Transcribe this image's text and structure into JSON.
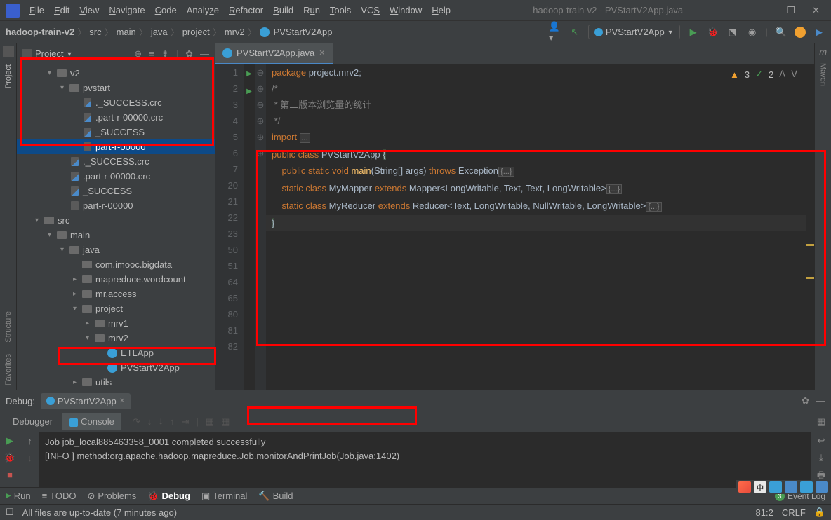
{
  "titlebar": {
    "menu": [
      "File",
      "Edit",
      "View",
      "Navigate",
      "Code",
      "Analyze",
      "Refactor",
      "Build",
      "Run",
      "Tools",
      "VCS",
      "Window",
      "Help"
    ],
    "title": "hadoop-train-v2 - PVStartV2App.java"
  },
  "breadcrumb": [
    "hadoop-train-v2",
    "src",
    "main",
    "java",
    "project",
    "mrv2",
    "PVStartV2App"
  ],
  "runconfig": "PVStartV2App",
  "project": {
    "title": "Project",
    "tree": [
      {
        "depth": 2,
        "arrow": "▾",
        "icon": "folder",
        "label": "v2"
      },
      {
        "depth": 3,
        "arrow": "▾",
        "icon": "folder",
        "label": "pvstart"
      },
      {
        "depth": 4,
        "arrow": "",
        "icon": "file-blue",
        "label": "._SUCCESS.crc"
      },
      {
        "depth": 4,
        "arrow": "",
        "icon": "file-blue",
        "label": ".part-r-00000.crc"
      },
      {
        "depth": 4,
        "arrow": "",
        "icon": "file-blue",
        "label": "_SUCCESS"
      },
      {
        "depth": 4,
        "arrow": "",
        "icon": "file",
        "label": "part-r-00000",
        "selected": true
      },
      {
        "depth": 3,
        "arrow": "",
        "icon": "file-blue",
        "label": "._SUCCESS.crc"
      },
      {
        "depth": 3,
        "arrow": "",
        "icon": "file-blue",
        "label": ".part-r-00000.crc"
      },
      {
        "depth": 3,
        "arrow": "",
        "icon": "file-blue",
        "label": "_SUCCESS"
      },
      {
        "depth": 3,
        "arrow": "",
        "icon": "file",
        "label": "part-r-00000"
      },
      {
        "depth": 1,
        "arrow": "▾",
        "icon": "folder",
        "label": "src"
      },
      {
        "depth": 2,
        "arrow": "▾",
        "icon": "folder",
        "label": "main"
      },
      {
        "depth": 3,
        "arrow": "▾",
        "icon": "folder",
        "label": "java"
      },
      {
        "depth": 4,
        "arrow": "",
        "icon": "folder",
        "label": "com.imooc.bigdata"
      },
      {
        "depth": 4,
        "arrow": "▸",
        "icon": "folder",
        "label": "mapreduce.wordcount"
      },
      {
        "depth": 4,
        "arrow": "▸",
        "icon": "folder",
        "label": "mr.access"
      },
      {
        "depth": 4,
        "arrow": "▾",
        "icon": "folder",
        "label": "project"
      },
      {
        "depth": 5,
        "arrow": "▸",
        "icon": "folder",
        "label": "mrv1"
      },
      {
        "depth": 5,
        "arrow": "▾",
        "icon": "folder",
        "label": "mrv2"
      },
      {
        "depth": 6,
        "arrow": "",
        "icon": "class",
        "label": "ETLApp"
      },
      {
        "depth": 6,
        "arrow": "",
        "icon": "class",
        "label": "PVStartV2App"
      },
      {
        "depth": 4,
        "arrow": "▸",
        "icon": "folder",
        "label": "utils"
      }
    ]
  },
  "editor": {
    "tab": "PVStartV2App.java",
    "lines_no": [
      "1",
      "2",
      "3",
      "4",
      "5",
      "6",
      "7",
      "20",
      "21",
      "22",
      "23",
      "50",
      "51",
      "64",
      "65",
      "80",
      "81",
      "82"
    ],
    "warnings": "3",
    "checks": "2"
  },
  "code": {
    "l1_pkg": "package ",
    "l1_name": "project.mrv2;",
    "l3": "/*",
    "l4": " * 第二版本浏览量的统计",
    "l5": " */",
    "l7_imp": "import ",
    "l21_pub": "public ",
    "l21_cls": "class ",
    "l21_name": "PVStartV2App ",
    "l21_br": "{",
    "l23_ps": "public static ",
    "l23_void": "void ",
    "l23_main": "main",
    "l23_args": "(String[] args) ",
    "l23_throws": "throws ",
    "l23_exc": "Exception",
    "l51_sc": "static ",
    "l51_cls": "class ",
    "l51_name": "MyMapper ",
    "l51_ext": "extends ",
    "l51_sig": "Mapper<LongWritable, Text, Text, LongWritable>",
    "l65_sc": "static ",
    "l65_cls": "class ",
    "l65_name": "MyReducer ",
    "l65_ext": "extends ",
    "l65_sig": "Reducer<Text, LongWritable, NullWritable, LongWritable>",
    "l81": "}",
    "fold": "{...}",
    "fold_dots": "..."
  },
  "debug": {
    "label": "Debug:",
    "tab": "PVStartV2App",
    "subtabs": {
      "debugger": "Debugger",
      "console": "Console"
    },
    "console": [
      "Job job_local885463358_0001 completed successfully",
      "[INFO ] method:org.apache.hadoop.mapreduce.Job.monitorAndPrintJob(Job.java:1402)"
    ]
  },
  "bottombar": {
    "run": "Run",
    "todo": "TODO",
    "problems": "Problems",
    "debug": "Debug",
    "terminal": "Terminal",
    "build": "Build",
    "eventlog": "Event Log",
    "eventbadge": "3"
  },
  "statusbar": {
    "msg": "All files are up-to-date (7 minutes ago)",
    "pos": "81:2",
    "lineend": "CRLF"
  },
  "sidebar": {
    "project": "Project",
    "structure": "Structure",
    "favorites": "Favorites",
    "maven": "Maven"
  }
}
